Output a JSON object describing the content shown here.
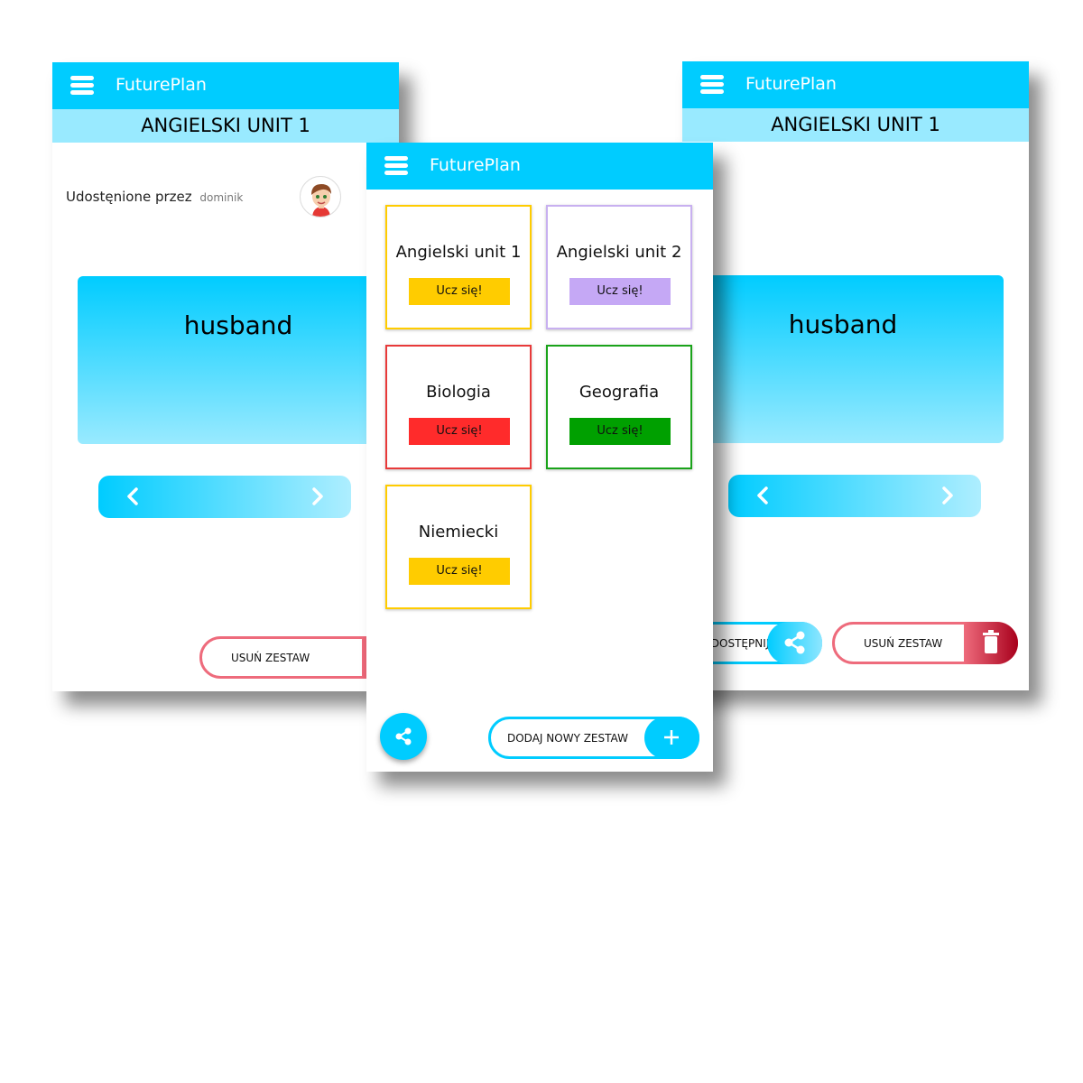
{
  "app": {
    "title": "FuturePlan"
  },
  "left_screen": {
    "set_title": "ANGIELSKI UNIT 1",
    "shared_by_label": "Udostęnione przez",
    "shared_by_user": "dominik",
    "card_word": "husband",
    "delete_label": "USUŃ ZESTAW"
  },
  "right_screen": {
    "set_title": "ANGIELSKI UNIT 1",
    "card_word": "husband",
    "share_label": "UDOSTĘPNIJ",
    "delete_label": "USUŃ ZESTAW"
  },
  "center_screen": {
    "sets": [
      {
        "name": "Angielski unit 1",
        "button": "Ucz się!",
        "border": "#ffcc00",
        "button_color": "#ffcc00"
      },
      {
        "name": "Angielski unit 2",
        "button": "Ucz się!",
        "border": "#c8b0f0",
        "button_color": "#c5a8f5"
      },
      {
        "name": "Biologia",
        "button": "Ucz się!",
        "border": "#e83a3a",
        "button_color": "#ff2b2b"
      },
      {
        "name": "Geografia",
        "button": "Ucz się!",
        "border": "#1aa31a",
        "button_color": "#00a000"
      },
      {
        "name": "Niemiecki",
        "button": "Ucz się!",
        "border": "#ffcc00",
        "button_color": "#ffcc00"
      }
    ],
    "add_label": "DODAJ NOWY ZESTAW"
  },
  "colors": {
    "primary": "#00ccff",
    "primary_light": "#99eaff",
    "danger": "#ee6b7c",
    "danger_dark": "#a8001c"
  },
  "icons": [
    "menu-icon",
    "chevron-left-icon",
    "chevron-right-icon",
    "trash-icon",
    "share-icon",
    "plus-icon",
    "avatar-boy"
  ]
}
